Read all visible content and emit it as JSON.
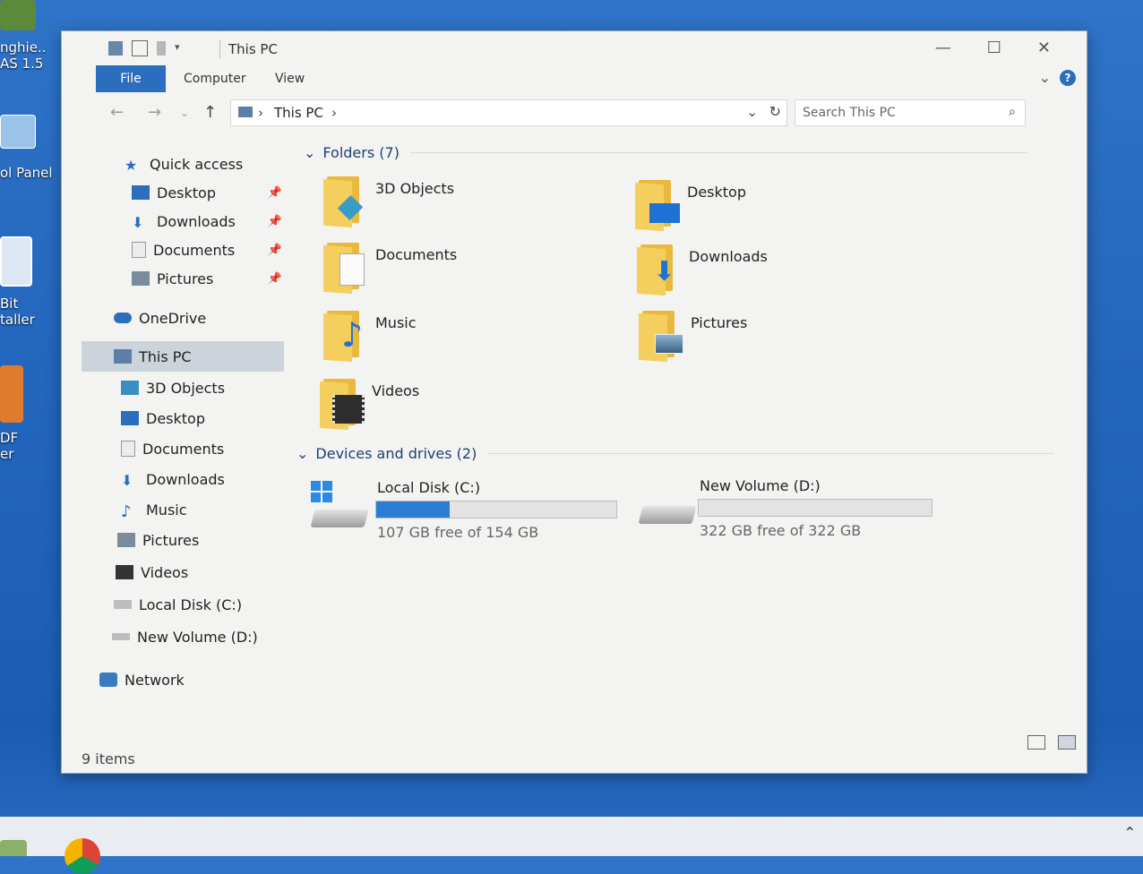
{
  "desktop": {
    "icons": [
      {
        "label": "nghie..",
        "sub": "AS 1.5"
      },
      {
        "label": "ol Panel"
      },
      {
        "label": "Bit",
        "sub": "taller"
      },
      {
        "label": "DF",
        "sub": "er"
      }
    ]
  },
  "window": {
    "title": "This PC",
    "tabs": [
      "File",
      "Computer",
      "View"
    ],
    "address": {
      "crumb": "This PC"
    },
    "search_placeholder": "Search This PC"
  },
  "nav": {
    "quick_access": "Quick access",
    "quick_items": [
      "Desktop",
      "Downloads",
      "Documents",
      "Pictures"
    ],
    "onedrive": "OneDrive",
    "this_pc": "This PC",
    "pc_items": [
      "3D Objects",
      "Desktop",
      "Documents",
      "Downloads",
      "Music",
      "Pictures",
      "Videos",
      "Local Disk (C:)",
      "New Volume (D:)"
    ],
    "network": "Network"
  },
  "content": {
    "folders_header": "Folders (7)",
    "folders": [
      "3D Objects",
      "Desktop",
      "Documents",
      "Downloads",
      "Music",
      "Pictures",
      "Videos"
    ],
    "drives_header": "Devices and drives (2)",
    "drives": [
      {
        "name": "Local Disk (C:)",
        "free_text": "107 GB free of 154 GB",
        "used_fraction": 0.305
      },
      {
        "name": "New Volume (D:)",
        "free_text": "322 GB free of 322 GB",
        "used_fraction": 0.0
      }
    ]
  },
  "status": {
    "items": "9 items"
  },
  "colors": {
    "accent": "#2a6ebd",
    "folder": "#f5cf5e",
    "drive_fill": "#2b7dd4"
  }
}
